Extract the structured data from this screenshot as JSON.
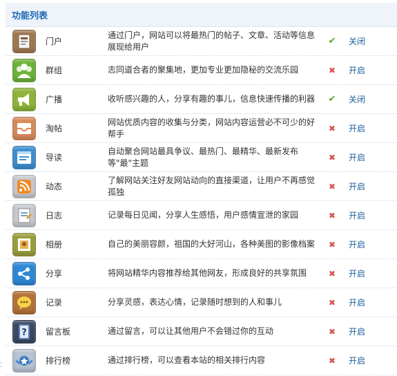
{
  "header": {
    "title": "功能列表"
  },
  "rows": [
    {
      "icon": "portal-icon",
      "color": "#a07a52",
      "name": "门户",
      "desc": "通过门户，网站可以将最热门的帖子、文章、活动等信息展现给用户",
      "enabled": true,
      "action": "关闭"
    },
    {
      "icon": "group-icon",
      "color": "#6fb33b",
      "name": "群组",
      "desc": "志同道合者的聚集地，更加专业更加隐秘的交流乐园",
      "enabled": false,
      "action": "开启"
    },
    {
      "icon": "broadcast-icon",
      "color": "#8fb53a",
      "name": "广播",
      "desc": "收听感兴趣的人，分享有趣的事儿，信息快速传播的利器",
      "enabled": true,
      "action": "关闭"
    },
    {
      "icon": "collection-icon",
      "color": "#d98b5a",
      "name": "淘帖",
      "desc": "网站优质内容的收集与分类，网站内容运营必不可少的好帮手",
      "enabled": false,
      "action": "开启"
    },
    {
      "icon": "guide-icon",
      "color": "#3d8fd1",
      "name": "导读",
      "desc": "自动聚合网站最具争议、最热门、最精华、最新发布等\"最\"主题",
      "enabled": false,
      "action": "开启"
    },
    {
      "icon": "feed-icon",
      "color": "#c6cbd1",
      "name": "动态",
      "desc": "了解网站关注好友网站动向的直接渠道，让用户不再感觉孤独",
      "enabled": false,
      "action": "开启"
    },
    {
      "icon": "diary-icon",
      "color": "#c8ccd2",
      "name": "日志",
      "desc": "记录每日见闻，分享人生感悟，用户感情宣泄的家园",
      "enabled": false,
      "action": "开启"
    },
    {
      "icon": "album-icon",
      "color": "#9a9f3c",
      "name": "相册",
      "desc": "自己的美丽容颜，祖国的大好河山，各种美图的影像档案",
      "enabled": false,
      "action": "开启"
    },
    {
      "icon": "share-icon",
      "color": "#2f89d6",
      "name": "分享",
      "desc": "将网站精华内容推荐给其他网友，形成良好的共享氛围",
      "enabled": false,
      "action": "开启"
    },
    {
      "icon": "record-icon",
      "color": "#b5733a",
      "name": "记录",
      "desc": "分享灵感，表达心情，记录随时想到的人和事儿",
      "enabled": false,
      "action": "开启"
    },
    {
      "icon": "guestbook-icon",
      "color": "#3b4a63",
      "name": "留言板",
      "desc": "通过留言，可以让其他用户不会错过你的互动",
      "enabled": false,
      "action": "开启"
    },
    {
      "icon": "ranking-icon",
      "color": "#b8c4d2",
      "name": "排行榜",
      "desc": "通过排行榜，可以查看本站的相关排行内容",
      "enabled": false,
      "action": "开启"
    }
  ]
}
